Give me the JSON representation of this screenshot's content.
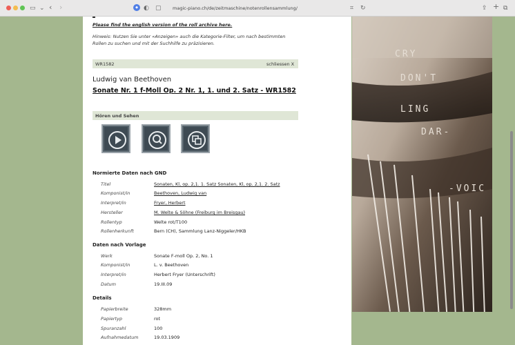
{
  "browser": {
    "url": "magic-piano.ch/de/zeitmaschine/notenrollensammlung/"
  },
  "intro": {
    "english_link": "Please find the english version of the roll archive here.",
    "hint_line1": "Hinweis: Nutzen Sie unter «Anzeigen» auch die Kategorie-Filter, um nach bestimmten",
    "hint_line2": "Rollen zu suchen und mit der Suchhilfe zu präzisieren."
  },
  "record": {
    "id": "WR1582",
    "close_label": "schliessen X",
    "composer": "Ludwig van Beethoven",
    "title": "Sonate Nr. 1 f-Moll Op. 2 Nr. 1, 1. und 2. Satz - WR1582"
  },
  "media": {
    "heading": "Hören und Sehen",
    "buttons": [
      "play-icon",
      "search-icon",
      "copy-icon"
    ]
  },
  "gnd": {
    "heading": "Normierte Daten nach GND",
    "rows": [
      {
        "label": "Titel",
        "value": "Sonaten, Kl, op. 2,1. 1. Satz Sonaten, Kl, op. 2,1. 2. Satz"
      },
      {
        "label": "Komponist/in",
        "value": "Beethoven, Ludwig van"
      },
      {
        "label": "Interpret/in",
        "value": "Fryer, Herbert"
      },
      {
        "label": "Hersteller",
        "value": "M. Welte & Söhne (Freiburg im Breisgau)"
      },
      {
        "label": "Rollentyp",
        "value": "Welte rot/T100"
      },
      {
        "label": "Rollenherkunft",
        "value": "Bern (CH), Sammlung Lanz-Niggeler/HKB"
      }
    ]
  },
  "vorlage": {
    "heading": "Daten nach Vorlage",
    "rows": [
      {
        "label": "Werk",
        "value": "Sonate F-moll Op. 2, No. 1"
      },
      {
        "label": "Komponist/in",
        "value": "L. v. Beethoven"
      },
      {
        "label": "Interpret/in",
        "value": "Herbert Fryer (Unterschrift)"
      },
      {
        "label": "Datum",
        "value": "19.III.09"
      }
    ]
  },
  "details": {
    "heading": "Details",
    "rows": [
      {
        "label": "Papierbreite",
        "value": "328mm"
      },
      {
        "label": "Papiertyp",
        "value": "rot"
      },
      {
        "label": "Spuranzahl",
        "value": "100"
      },
      {
        "label": "Aufnahmedatum",
        "value": "19.03.1909"
      }
    ]
  },
  "photo": {
    "roll_text": [
      "CRY",
      "DON'T",
      "LING",
      "DAR-",
      "-VOIC"
    ]
  }
}
